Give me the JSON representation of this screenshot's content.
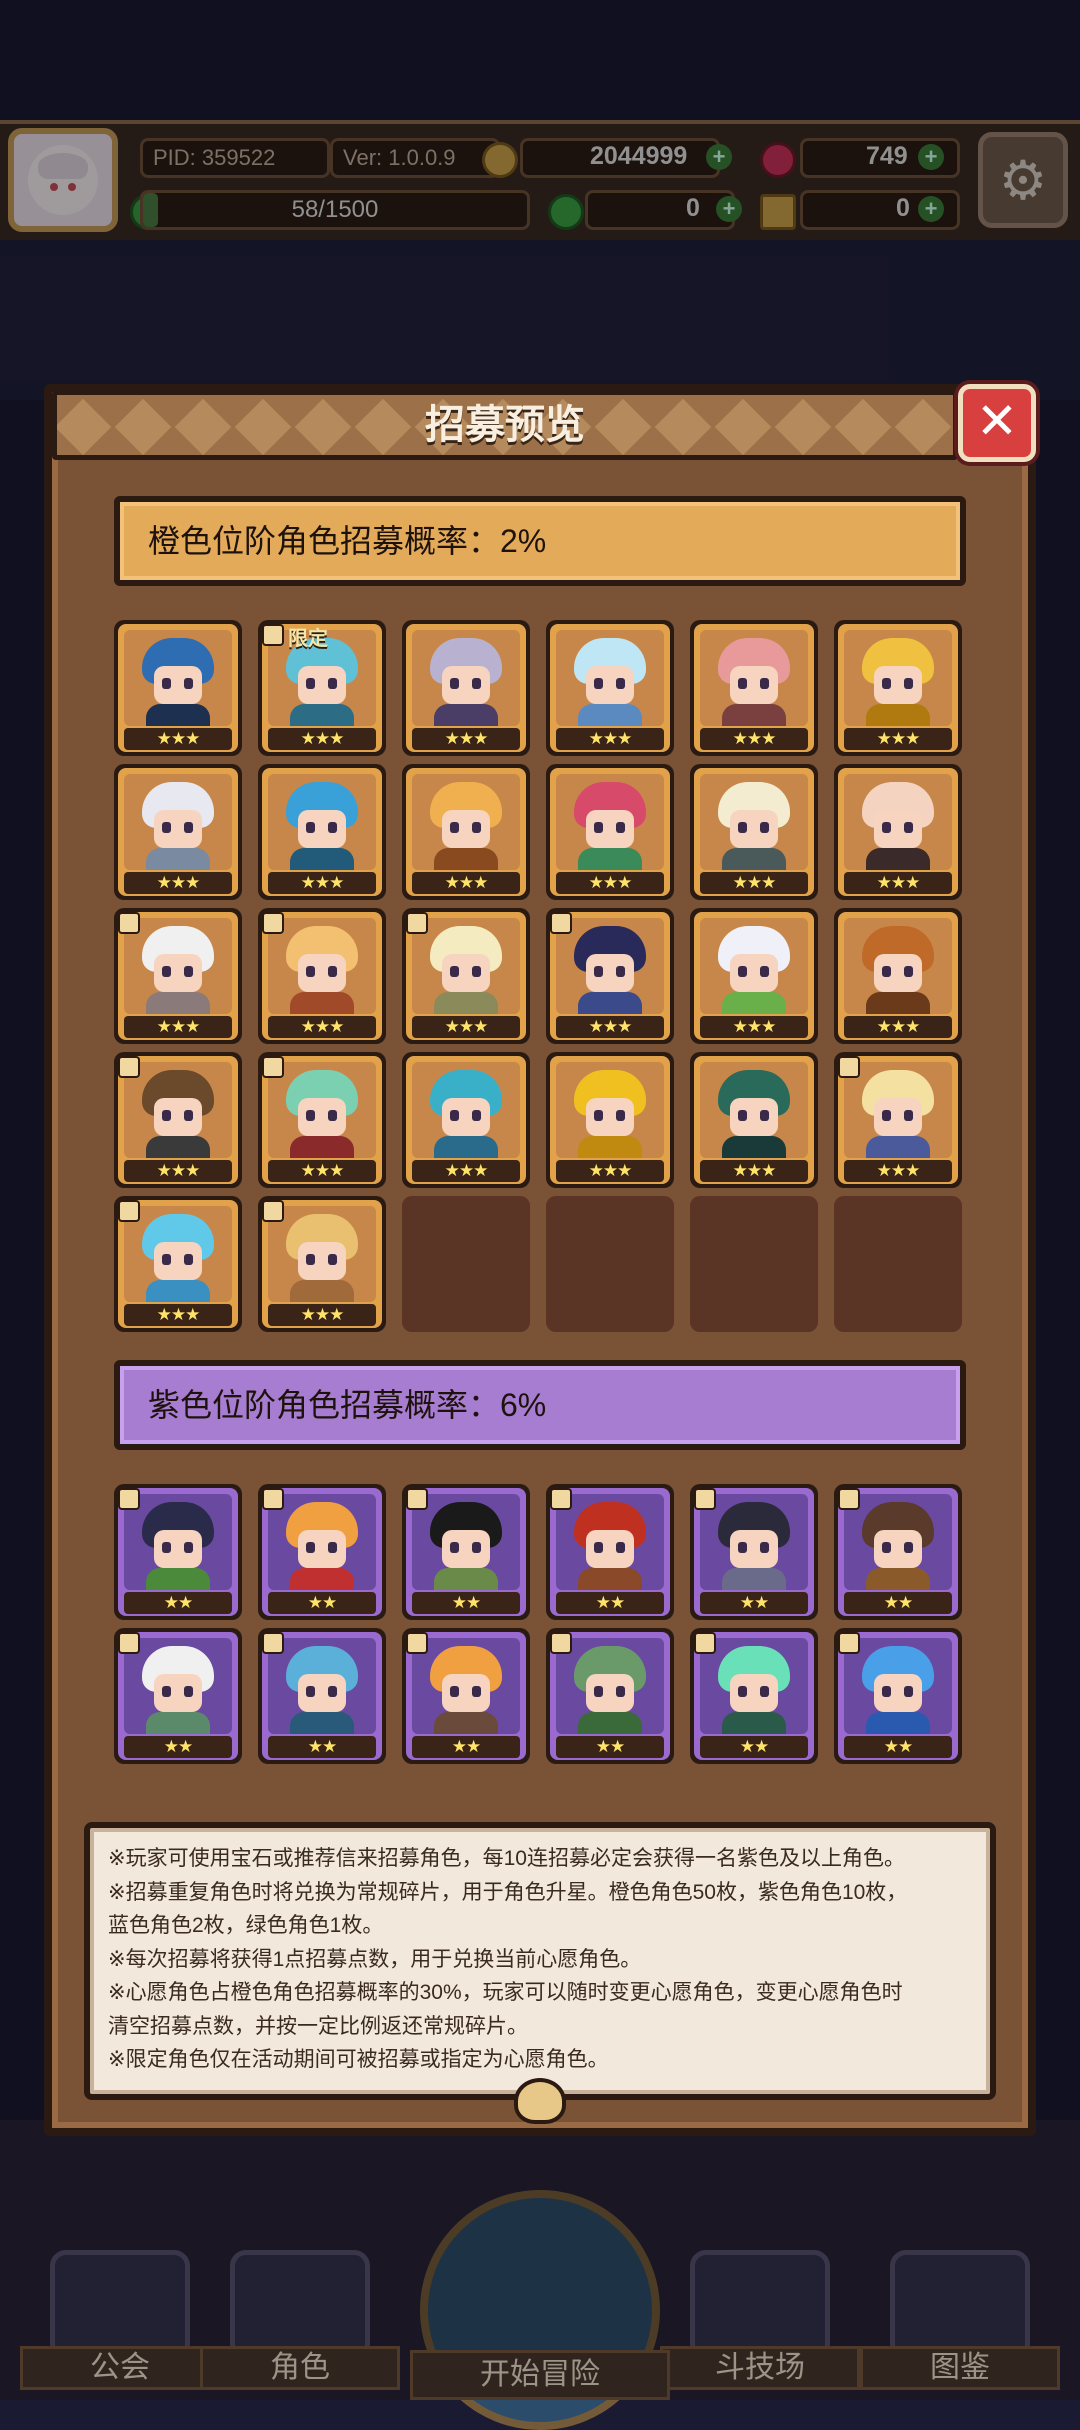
{
  "header": {
    "pid": "PID: 359522",
    "version": "Ver: 1.0.0.9",
    "gold": "2044999",
    "gems": "749",
    "stamina": "58/1500",
    "stamina_fraction": 0.039,
    "item_a": "0",
    "item_b": "0"
  },
  "dialog": {
    "title": "招募预览",
    "close_label": "✕"
  },
  "orange_section": {
    "banner": "橙色位阶角色招募概率：2%",
    "stars": "★★★",
    "limited_tag": "限定",
    "characters": [
      {
        "hair": "#2e6db2",
        "body": "#1d3050",
        "limited": false,
        "corner": false
      },
      {
        "hair": "#5fc0d6",
        "body": "#2c6c84",
        "limited": true,
        "corner": true
      },
      {
        "hair": "#b8b2d0",
        "body": "#4a3e66",
        "limited": false,
        "corner": false
      },
      {
        "hair": "#bfe6f4",
        "body": "#5a8ac0",
        "limited": false,
        "corner": false
      },
      {
        "hair": "#e89a9a",
        "body": "#7a4040",
        "limited": false,
        "corner": false
      },
      {
        "hair": "#f0c040",
        "body": "#b07a10",
        "limited": false,
        "corner": false
      },
      {
        "hair": "#e8e8f0",
        "body": "#7a8aa0",
        "limited": false,
        "corner": false
      },
      {
        "hair": "#3aa0d8",
        "body": "#225a7a",
        "limited": false,
        "corner": false
      },
      {
        "hair": "#f0b050",
        "body": "#8a4a20",
        "limited": false,
        "corner": false
      },
      {
        "hair": "#d84a6a",
        "body": "#3a8a5a",
        "limited": false,
        "corner": false
      },
      {
        "hair": "#f4ecd0",
        "body": "#4a5a5a",
        "limited": false,
        "corner": false
      },
      {
        "hair": "#f4d4c0",
        "body": "#3a2a2a",
        "limited": false,
        "corner": false
      },
      {
        "hair": "#f0f0f0",
        "body": "#8a7a7a",
        "limited": false,
        "corner": true
      },
      {
        "hair": "#f2c070",
        "body": "#a04a2a",
        "limited": false,
        "corner": true
      },
      {
        "hair": "#f4ecc0",
        "body": "#8a8a5a",
        "limited": false,
        "corner": true
      },
      {
        "hair": "#2a2a5a",
        "body": "#3a4a8a",
        "limited": false,
        "corner": true
      },
      {
        "hair": "#f0f0f8",
        "body": "#6ab04a",
        "limited": false,
        "corner": false
      },
      {
        "hair": "#c06a2a",
        "body": "#6a3a1a",
        "limited": false,
        "corner": false
      },
      {
        "hair": "#6a4a2a",
        "body": "#3a3a3a",
        "limited": false,
        "corner": true
      },
      {
        "hair": "#7ad0b0",
        "body": "#8a2a2a",
        "limited": false,
        "corner": true
      },
      {
        "hair": "#3ab0c8",
        "body": "#2a6a8a",
        "limited": false,
        "corner": false
      },
      {
        "hair": "#f0c020",
        "body": "#c08a10",
        "limited": false,
        "corner": false
      },
      {
        "hair": "#2a6a5a",
        "body": "#1a3a3a",
        "limited": false,
        "corner": false
      },
      {
        "hair": "#f4e0a0",
        "body": "#4a5a9a",
        "limited": false,
        "corner": true
      },
      {
        "hair": "#60c8e8",
        "body": "#3a90c0",
        "limited": false,
        "corner": true
      },
      {
        "hair": "#e8c070",
        "body": "#a06a3a",
        "limited": false,
        "corner": true
      }
    ]
  },
  "purple_section": {
    "banner": "紫色位阶角色招募概率：6%",
    "stars": "★★",
    "characters": [
      {
        "hair": "#2a2a4a",
        "body": "#4a8a3a",
        "corner": true
      },
      {
        "hair": "#f0a040",
        "body": "#c03030",
        "corner": true
      },
      {
        "hair": "#1a1a1a",
        "body": "#6a8a4a",
        "corner": true
      },
      {
        "hair": "#c03020",
        "body": "#8a4a2a",
        "corner": true
      },
      {
        "hair": "#2a2a3a",
        "body": "#6a6a8a",
        "corner": true
      },
      {
        "hair": "#5a3a2a",
        "body": "#8a5a2a",
        "corner": true
      },
      {
        "hair": "#f0f0f0",
        "body": "#5a8a6a",
        "corner": true
      },
      {
        "hair": "#5ab0d8",
        "body": "#2a5a7a",
        "corner": true
      },
      {
        "hair": "#f0a040",
        "body": "#6a4a3a",
        "corner": true
      },
      {
        "hair": "#6a9a6a",
        "body": "#3a6a3a",
        "corner": true
      },
      {
        "hair": "#6ae0b8",
        "body": "#2a5a4a",
        "corner": true
      },
      {
        "hair": "#4aa0e8",
        "body": "#2a5ab0",
        "corner": true
      }
    ]
  },
  "notes": [
    "※玩家可使用宝石或推荐信来招募角色，每10连招募必定会获得一名紫色及以上角色。",
    "※招募重复角色时将兑换为常规碎片，用于角色升星。橙色角色50枚，紫色角色10枚，",
    "蓝色角色2枚，绿色角色1枚。",
    "※每次招募将获得1点招募点数，用于兑换当前心愿角色。",
    "※心愿角色占橙色角色招募概率的30%，玩家可以随时变更心愿角色，变更心愿角色时",
    "清空招募点数，并按一定比例返还常规碎片。",
    "※限定角色仅在活动期间可被招募或指定为心愿角色。"
  ],
  "nav": {
    "guild": "公会",
    "character": "角色",
    "adventure": "开始冒险",
    "arena": "斗技场",
    "codex": "图鉴"
  }
}
